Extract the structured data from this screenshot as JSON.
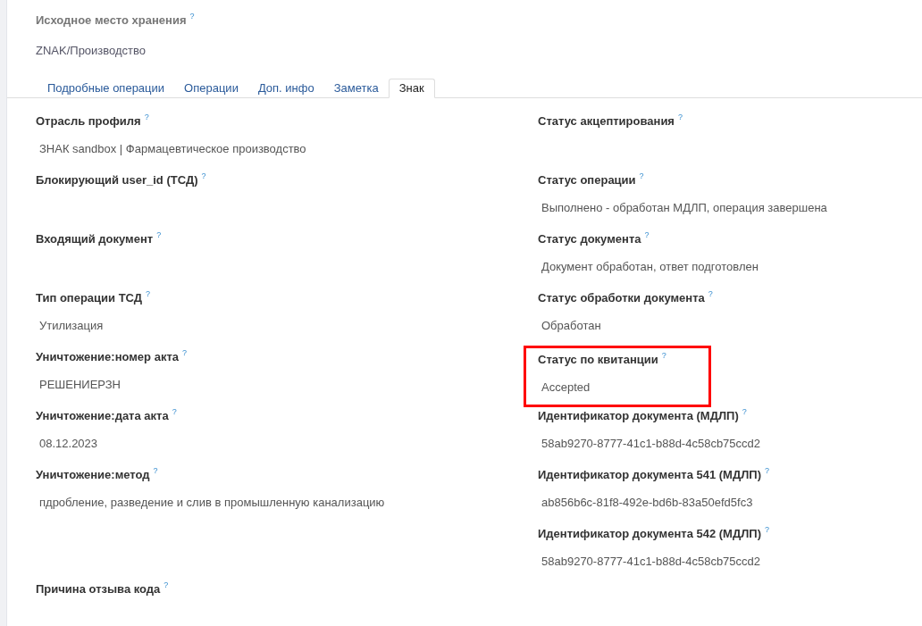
{
  "header": {
    "label": "Исходное место хранения",
    "value": "ZNAK/Производство"
  },
  "tabs": [
    {
      "label": "Подробные операции",
      "selected": false
    },
    {
      "label": "Операции",
      "selected": false
    },
    {
      "label": "Доп. инфо",
      "selected": false
    },
    {
      "label": "Заметка",
      "selected": false
    },
    {
      "label": "Знак",
      "selected": true
    }
  ],
  "help_mark": "?",
  "left_fields": [
    {
      "label": "Отрасль профиля",
      "value": "ЗНАК sandbox | Фармацевтическое производство",
      "highlighted": false
    },
    {
      "label": "Блокирующий user_id (ТСД)",
      "highlighted": false
    },
    {
      "label": "Входящий документ",
      "highlighted": false
    },
    {
      "label": "Тип операции ТСД",
      "value": "Утилизация",
      "highlighted": false
    },
    {
      "label": "Уничтожение:номер акта",
      "value": "РЕШЕНИЕРЗН",
      "highlighted": false
    },
    {
      "label": "Уничтожение:дата акта",
      "value": "08.12.2023",
      "highlighted": false
    },
    {
      "label": "Уничтожение:метод",
      "value": "пдробление, разведение и слив в промышленную канализацию",
      "highlighted": false
    },
    {
      "label": "Причина отзыва кода",
      "highlighted": false
    }
  ],
  "right_fields": [
    {
      "label": "Статус акцептирования",
      "highlighted": false
    },
    {
      "label": "Статус операции",
      "value": "Выполнено - обработан МДЛП, операция завершена",
      "highlighted": false
    },
    {
      "label": "Статус документа",
      "value": "Документ обработан, ответ подготовлен",
      "highlighted": false
    },
    {
      "label": "Статус обработки документа",
      "value": "Обработан",
      "highlighted": false
    },
    {
      "label": "Статус по квитанции",
      "value": "Accepted",
      "highlighted": true
    },
    {
      "label": "Идентификатор документа (МДЛП)",
      "value": "58ab9270-8777-41c1-b88d-4c58cb75ccd2",
      "highlighted": false
    },
    {
      "label": "Идентификатор документа 541 (МДЛП)",
      "value": "ab856b6c-81f8-492e-bd6b-83a50efd5fc3",
      "highlighted": false
    },
    {
      "label": "Идентификатор документа 542 (МДЛП)",
      "value": "58ab9270-8777-41c1-b88d-4c58cb75ccd2",
      "highlighted": false
    }
  ]
}
